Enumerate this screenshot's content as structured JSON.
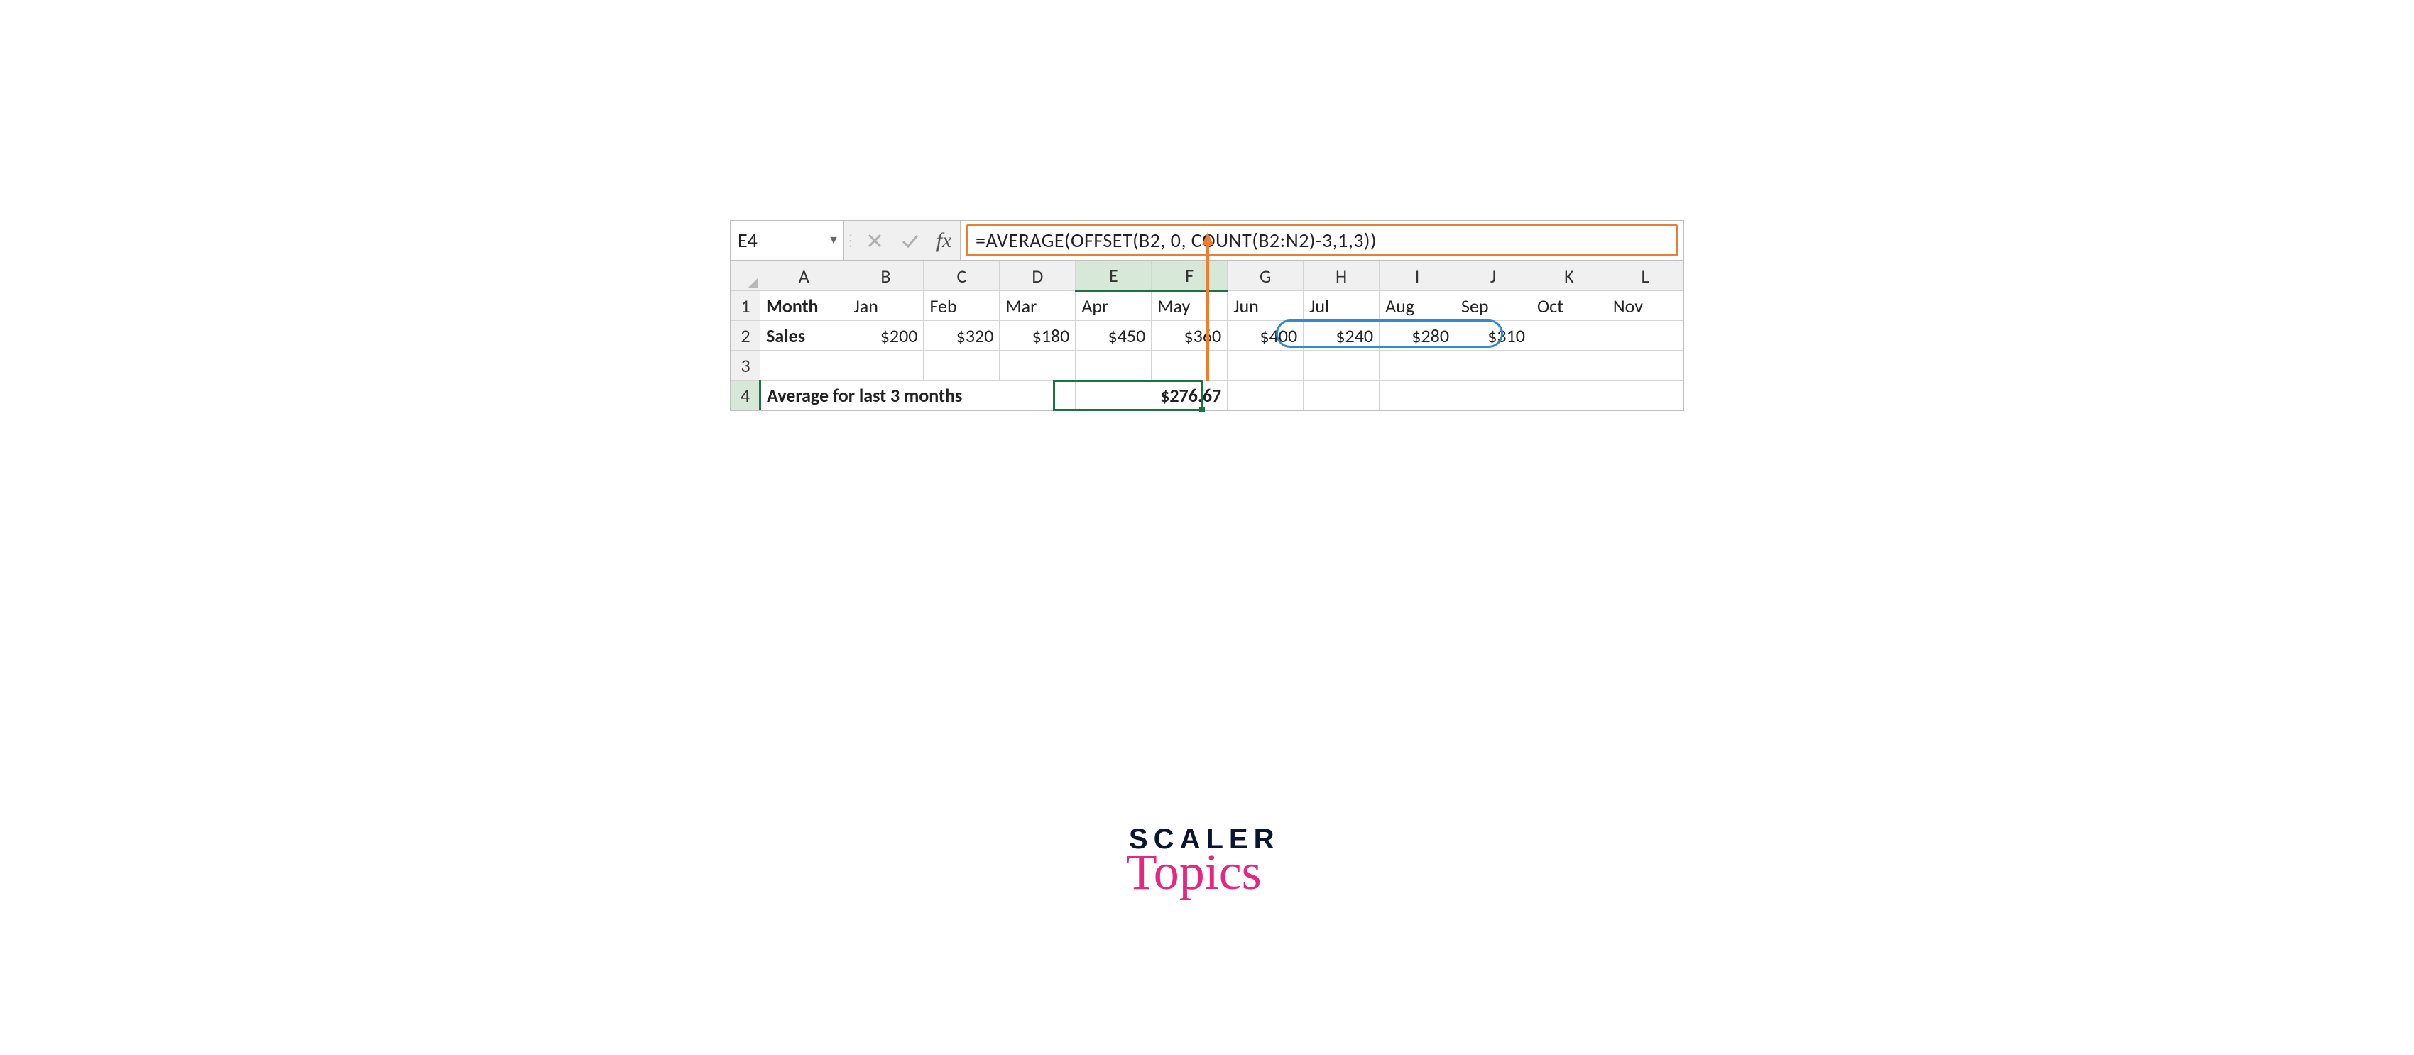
{
  "formula_bar": {
    "cell_ref": "E4",
    "fx_label": "fx",
    "formula": "=AVERAGE(OFFSET(B2, 0, COUNT(B2:N2)-3,1,3))"
  },
  "columns": [
    "A",
    "B",
    "C",
    "D",
    "E",
    "F",
    "G",
    "H",
    "I",
    "J",
    "K",
    "L"
  ],
  "row_numbers": [
    "1",
    "2",
    "3",
    "4"
  ],
  "labels": {
    "month": "Month",
    "sales": "Sales",
    "avg_label": "Average for last 3 months"
  },
  "months": [
    "Jan",
    "Feb",
    "Mar",
    "Apr",
    "May",
    "Jun",
    "Jul",
    "Aug",
    "Sep",
    "Oct",
    "Nov"
  ],
  "sales": [
    "$200",
    "$320",
    "$180",
    "$450",
    "$360",
    "$400",
    "$240",
    "$280",
    "$310",
    "",
    ""
  ],
  "avg_value": "$276.67",
  "branding": {
    "line1": "SCALER",
    "line2": "Topics"
  },
  "chart_data": {
    "type": "table",
    "title": "Sales by Month",
    "categories": [
      "Jan",
      "Feb",
      "Mar",
      "Apr",
      "May",
      "Jun",
      "Jul",
      "Aug",
      "Sep"
    ],
    "values": [
      200,
      320,
      180,
      450,
      360,
      400,
      240,
      280,
      310
    ],
    "derived": {
      "label": "Average for last 3 months",
      "value": 276.67
    }
  }
}
